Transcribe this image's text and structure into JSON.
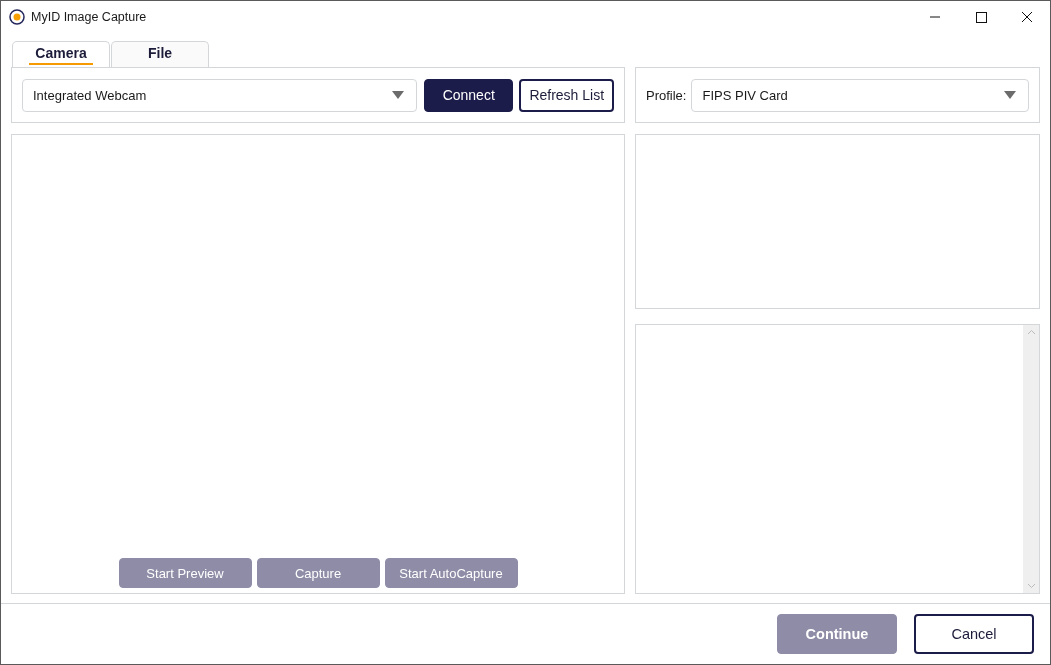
{
  "window": {
    "title": "MyID Image Capture"
  },
  "tabs": [
    {
      "label": "Camera",
      "selected": true
    },
    {
      "label": "File",
      "selected": false
    }
  ],
  "camera": {
    "device": "Integrated Webcam",
    "buttons": [
      {
        "label": "Connect",
        "kind": "primary",
        "disabled": false
      },
      {
        "label": "Refresh List",
        "kind": "outline",
        "disabled": false
      }
    ]
  },
  "profile": {
    "label": "Profile:",
    "value": "FIPS PIV Card"
  },
  "preview_buttons": [
    {
      "label": "Start Preview",
      "disabled": true
    },
    {
      "label": "Capture",
      "disabled": true
    },
    {
      "label": "Start AutoCapture",
      "disabled": true
    }
  ],
  "footer_buttons": [
    {
      "label": "Continue",
      "disabled": true
    },
    {
      "label": "Cancel",
      "kind": "outline",
      "disabled": false
    }
  ]
}
